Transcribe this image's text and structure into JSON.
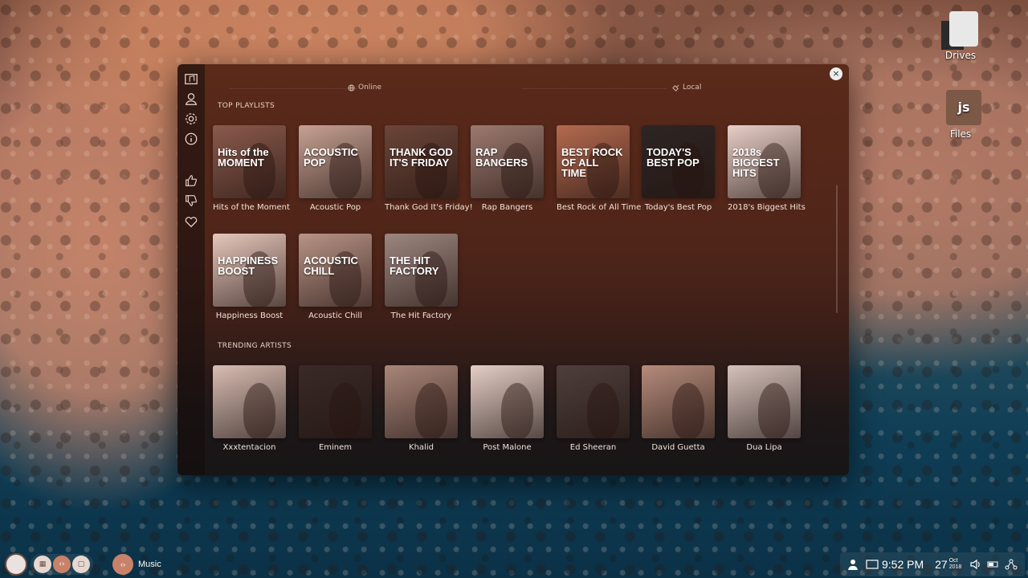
{
  "desktop": {
    "icons": [
      {
        "label": "Drives",
        "icon": "drive-icon"
      },
      {
        "label": "Files",
        "icon": "js-file-icon",
        "glyph": "js"
      }
    ]
  },
  "window": {
    "tabs": [
      {
        "label": "Online",
        "icon": "globe-icon"
      },
      {
        "label": "Local",
        "icon": "plug-icon"
      }
    ],
    "close_label": "×",
    "sidebar_icons": [
      "music-icon",
      "user-icon",
      "gear-icon",
      "info-icon",
      "thumbs-up-icon",
      "thumbs-down-icon",
      "heart-icon"
    ]
  },
  "top_playlists": {
    "title": "TOP PLAYLISTS",
    "items": [
      {
        "caption": "Hits of the Moment",
        "art_text": "Hits of the MOMENT",
        "color": "#8a5a4c"
      },
      {
        "caption": "Acoustic Pop",
        "art_text": "ACOUSTIC POP",
        "color": "#c6a193"
      },
      {
        "caption": "Thank God It's Friday!",
        "art_text": "THANK GOD IT'S FRIDAY",
        "color": "#6b4538"
      },
      {
        "caption": "Rap Bangers",
        "art_text": "RAP BANGERS",
        "color": "#9b7a70"
      },
      {
        "caption": "Best Rock of All Time",
        "art_text": "BEST ROCK OF ALL TIME",
        "color": "#b46a4f"
      },
      {
        "caption": "Today's Best Pop",
        "art_text": "TODAY'S BEST POP",
        "color": "#2e2523"
      },
      {
        "caption": "2018's Biggest Hits",
        "art_text": "2018s BIGGEST HITS",
        "color": "#e8cfc8"
      },
      {
        "caption": "Happiness Boost",
        "art_text": "HAPPINESS BOOST",
        "color": "#e5c6bb"
      },
      {
        "caption": "Acoustic Chill",
        "art_text": "ACOUSTIC CHILL",
        "color": "#b89386"
      },
      {
        "caption": "The Hit Factory",
        "art_text": "THE HIT FACTORY",
        "color": "#9d8680"
      }
    ]
  },
  "trending_artists": {
    "title": "TRENDING ARTISTS",
    "items": [
      {
        "caption": "Xxxtentacion",
        "color": "#d8bdb3"
      },
      {
        "caption": "Eminem",
        "color": "#3a2a27"
      },
      {
        "caption": "Khalid",
        "color": "#a98679"
      },
      {
        "caption": "Post Malone",
        "color": "#e4cec6"
      },
      {
        "caption": "Ed Sheeran",
        "color": "#4e3f3b"
      },
      {
        "caption": "David Guetta",
        "color": "#b58b7b"
      },
      {
        "caption": "Dua Lipa",
        "color": "#d5c1bb"
      }
    ]
  },
  "taskbar": {
    "app_label": "Music",
    "time": "9:52 PM",
    "day": "27",
    "month": "Oct",
    "year": "2018"
  }
}
